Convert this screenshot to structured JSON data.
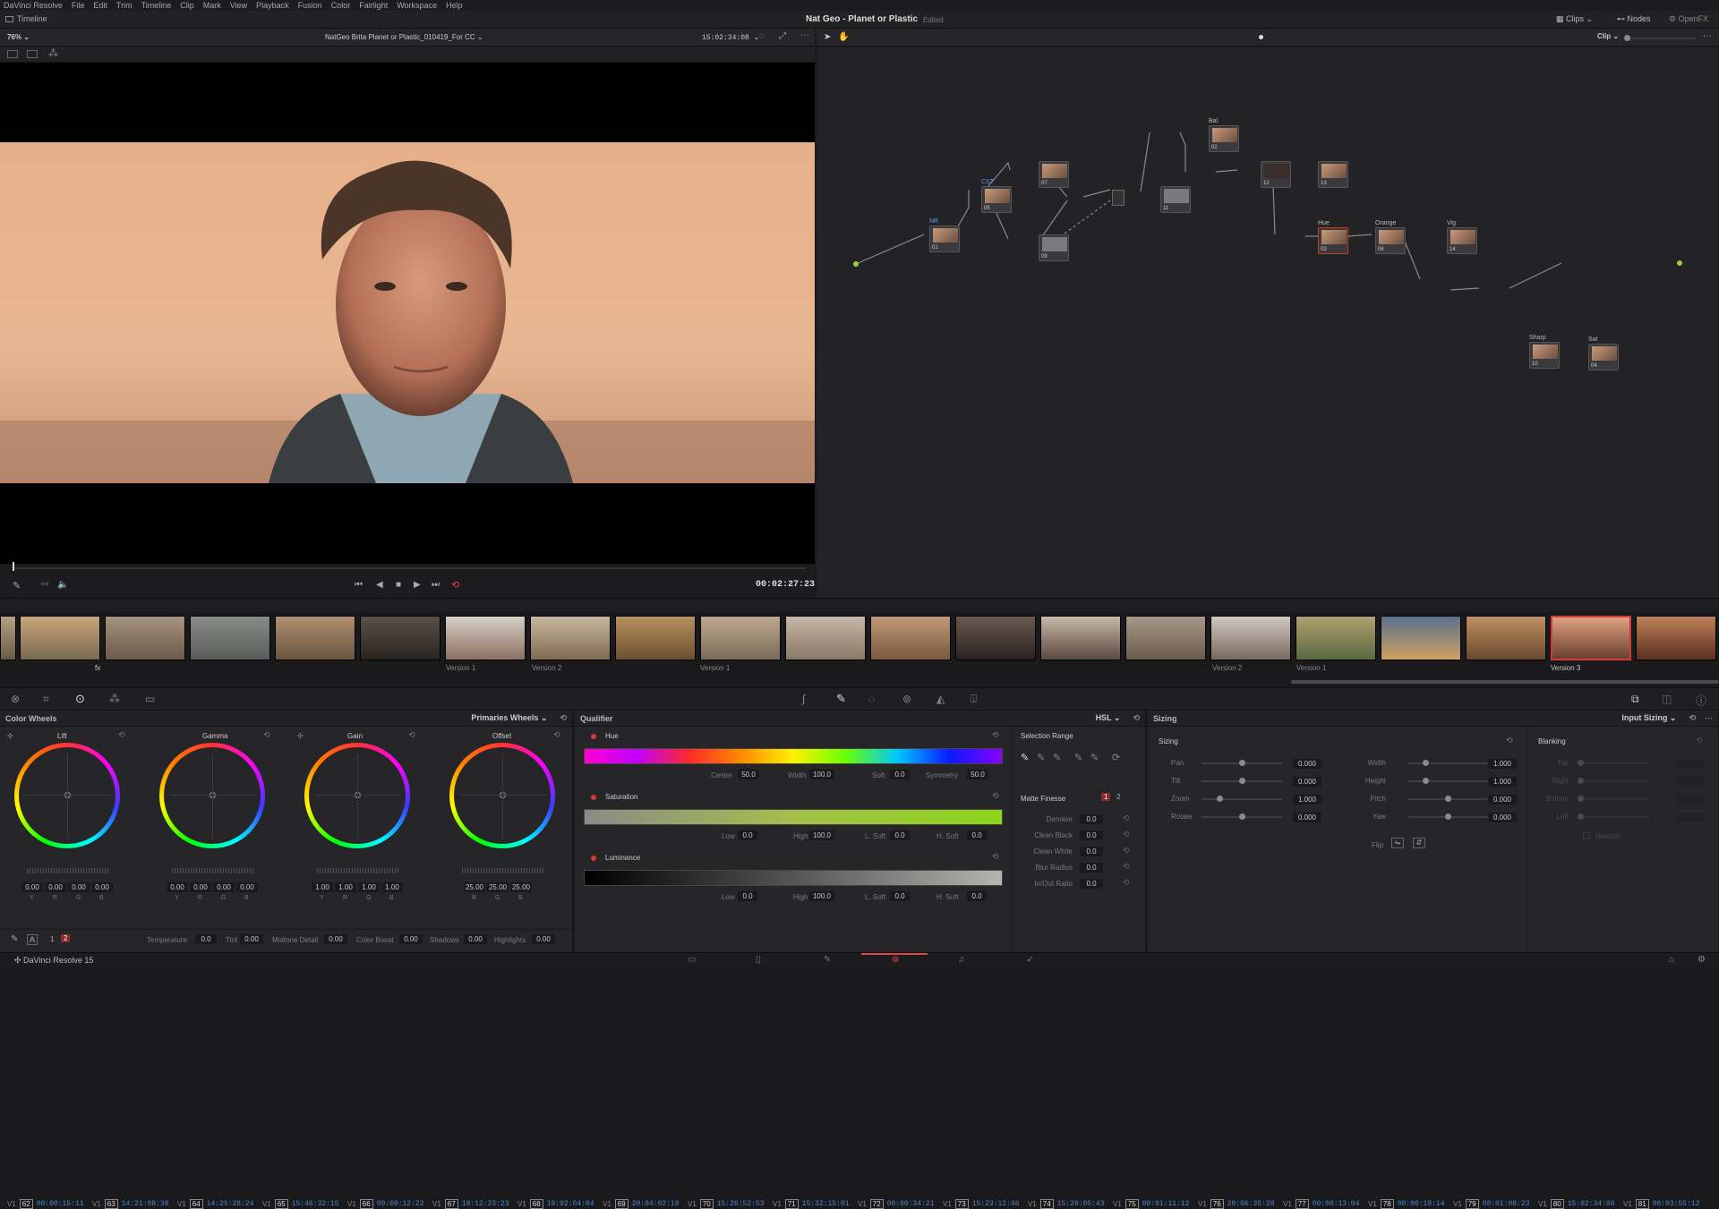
{
  "menu": {
    "items": [
      "DaVinci Resolve",
      "File",
      "Edit",
      "Trim",
      "Timeline",
      "Clip",
      "Mark",
      "View",
      "Playback",
      "Fusion",
      "Color",
      "Fairlight",
      "Workspace",
      "Help"
    ]
  },
  "title": {
    "project": "Nat Geo - Planet or Plastic",
    "status": "Edited",
    "timeline_label": "Timeline"
  },
  "top_right": {
    "clips": "Clips",
    "nodes": "Nodes",
    "openfx": "OpenFX"
  },
  "viewer": {
    "zoom": "76%",
    "clip_name": "NatGeo Brita Planet or Plastic_010419_For CC",
    "timecode": "15:02:34:08",
    "playhead_tc": "00:02:27:23"
  },
  "node_panel": {
    "mode": "Clip",
    "labels": {
      "nr": "NR",
      "cst": "CST",
      "bal": "Bal",
      "hue": "Hue",
      "orange": "Orange",
      "vig": "Vig",
      "sharp": "Sharp",
      "sat": "Sat"
    },
    "nums": {
      "n1": "01",
      "n2": "05",
      "n3": "07",
      "n4": "09",
      "n5": "11",
      "n6": "02",
      "n7": "12",
      "n8": "13",
      "n9": "03",
      "n10": "06",
      "n11": "14",
      "n12": "10",
      "n13": "04"
    }
  },
  "clips": [
    {
      "track": "V1",
      "num": "62",
      "tc": "00:00:15:11"
    },
    {
      "track": "V1",
      "num": "63",
      "tc": "14:21:08:38"
    },
    {
      "track": "V1",
      "num": "64",
      "tc": "14:25:28:24"
    },
    {
      "track": "V1",
      "num": "65",
      "tc": "15:46:32:15"
    },
    {
      "track": "V1",
      "num": "66",
      "tc": "00:00:12:22"
    },
    {
      "track": "V1",
      "num": "67",
      "tc": "19:12:23:23"
    },
    {
      "track": "V1",
      "num": "68",
      "tc": "19:02:04:04"
    },
    {
      "track": "V1",
      "num": "69",
      "tc": "20:04:02:18"
    },
    {
      "track": "V1",
      "num": "70",
      "tc": "15:26:52:53"
    },
    {
      "track": "V1",
      "num": "71",
      "tc": "15:32:15:01"
    },
    {
      "track": "V1",
      "num": "72",
      "tc": "00:00:34:21"
    },
    {
      "track": "V1",
      "num": "73",
      "tc": "15:23:12:46"
    },
    {
      "track": "V1",
      "num": "74",
      "tc": "15:29:05:43"
    },
    {
      "track": "V1",
      "num": "75",
      "tc": "00:01:11:12"
    },
    {
      "track": "V1",
      "num": "76",
      "tc": "20:06:35:28"
    },
    {
      "track": "V1",
      "num": "77",
      "tc": "00:00:13:04"
    },
    {
      "track": "V1",
      "num": "78",
      "tc": "00:00:19:14"
    },
    {
      "track": "V1",
      "num": "79",
      "tc": "00:01:08:23"
    },
    {
      "track": "V1",
      "num": "80",
      "tc": "15:02:34:08"
    },
    {
      "track": "V1",
      "num": "81",
      "tc": "00:03:55:12"
    }
  ],
  "versions": {
    "v1": "Version 1",
    "v2": "Version 2",
    "v3": "Version 1",
    "v4": "Version 2",
    "v5": "Version 1",
    "v6": "Version 3",
    "fx": "fx"
  },
  "color_wheels": {
    "title": "Color Wheels",
    "mode": "Primaries Wheels",
    "wheels": [
      {
        "name": "Lift",
        "vals": [
          "0.00",
          "0.00",
          "0.00",
          "0.00"
        ],
        "ch": [
          "Y",
          "R",
          "G",
          "B"
        ]
      },
      {
        "name": "Gamma",
        "vals": [
          "0.00",
          "0.00",
          "0.00",
          "0.00"
        ],
        "ch": [
          "Y",
          "R",
          "G",
          "B"
        ]
      },
      {
        "name": "Gain",
        "vals": [
          "1.00",
          "1.00",
          "1.00",
          "1.00"
        ],
        "ch": [
          "Y",
          "R",
          "G",
          "B"
        ]
      },
      {
        "name": "Offset",
        "vals": [
          "25.00",
          "25.00",
          "25.00"
        ],
        "ch": [
          "R",
          "G",
          "B"
        ]
      }
    ],
    "bottom": {
      "page1": "1",
      "page2": "2",
      "temp_l": "Temperature",
      "temp_v": "0.0",
      "tint_l": "Tint",
      "tint_v": "0.00",
      "md_l": "Midtone Detail",
      "md_v": "0.00",
      "cb_l": "Color Boost",
      "cb_v": "0.00",
      "sh_l": "Shadows",
      "sh_v": "0.00",
      "hl_l": "Highlights",
      "hl_v": "0.00"
    }
  },
  "qualifier": {
    "title": "Qualifier",
    "mode": "HSL",
    "hue": {
      "label": "Hue",
      "center_l": "Center",
      "center": "50.0",
      "width_l": "Width",
      "width": "100.0",
      "soft_l": "Soft",
      "soft": "0.0",
      "sym_l": "Symmetry",
      "sym": "50.0"
    },
    "sat": {
      "label": "Saturation",
      "low_l": "Low",
      "low": "0.0",
      "high_l": "High",
      "high": "100.0",
      "lsoft_l": "L. Soft",
      "lsoft": "0.0",
      "hsoft_l": "H. Soft",
      "hsoft": "0.0"
    },
    "lum": {
      "label": "Luminance",
      "low_l": "Low",
      "low": "0.0",
      "high_l": "High",
      "high": "100.0",
      "lsoft_l": "L. Soft",
      "lsoft": "0.0",
      "hsoft_l": "H. Soft",
      "hsoft": "0.0"
    },
    "selection_range": "Selection Range",
    "matte_finesse": "Matte Finesse",
    "mf_p1": "1",
    "mf_p2": "2",
    "mf": [
      {
        "l": "Denoise",
        "v": "0.0"
      },
      {
        "l": "Clean Black",
        "v": "0.0"
      },
      {
        "l": "Clean White",
        "v": "0.0"
      },
      {
        "l": "Blur Radius",
        "v": "0.0"
      },
      {
        "l": "In/Out Ratio",
        "v": "0.0"
      }
    ]
  },
  "sizing": {
    "title": "Sizing",
    "mode": "Input Sizing",
    "sub": "Sizing",
    "left": [
      {
        "l": "Pan",
        "v": "0.000",
        "pos": 0.5
      },
      {
        "l": "Tilt",
        "v": "0.000",
        "pos": 0.5
      },
      {
        "l": "Zoom",
        "v": "1.000",
        "pos": 0.2
      },
      {
        "l": "Rotate",
        "v": "0.000",
        "pos": 0.5
      }
    ],
    "right": [
      {
        "l": "Width",
        "v": "1.000",
        "pos": 0.2
      },
      {
        "l": "Height",
        "v": "1.000",
        "pos": 0.2
      },
      {
        "l": "Pitch",
        "v": "0.000",
        "pos": 0.5
      },
      {
        "l": "Yaw",
        "v": "0.000",
        "pos": 0.5
      }
    ],
    "flip": "Flip"
  },
  "blanking": {
    "title": "Blanking",
    "items": [
      "Top",
      "Right",
      "Bottom",
      "Left"
    ],
    "smooth": "Smooth"
  },
  "status": {
    "app": "DaVinci Resolve 15"
  }
}
